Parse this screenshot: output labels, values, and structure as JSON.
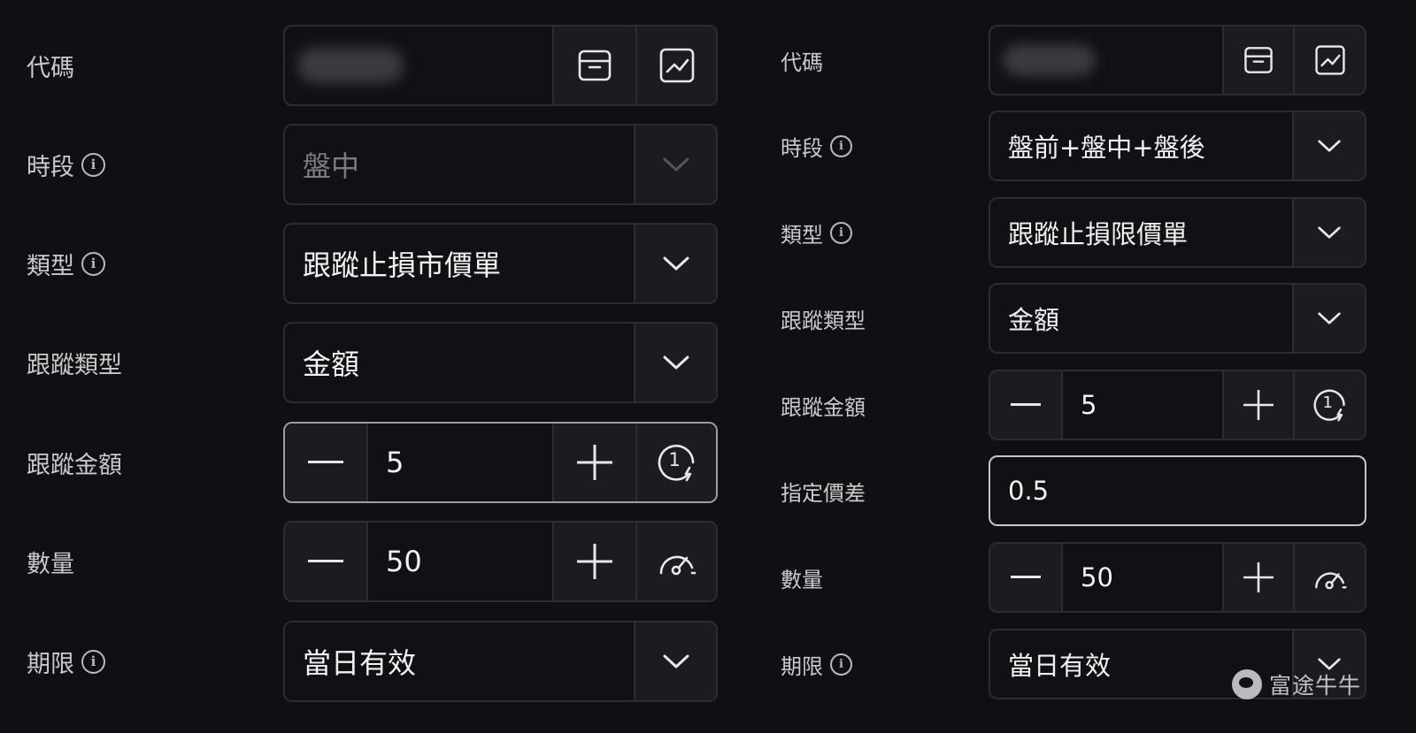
{
  "left": {
    "code": {
      "label": "代碼",
      "icons": [
        "store-icon",
        "chart-icon"
      ]
    },
    "session": {
      "label": "時段",
      "value": "盤中",
      "info": "i"
    },
    "type": {
      "label": "類型",
      "value": "跟蹤止損市價單",
      "info": "i"
    },
    "trail_type": {
      "label": "跟蹤類型",
      "value": "金額"
    },
    "trail_amount": {
      "label": "跟蹤金額",
      "value": "5",
      "badge": "1"
    },
    "quantity": {
      "label": "數量",
      "value": "50"
    },
    "validity": {
      "label": "期限",
      "value": "當日有效",
      "info": "i"
    }
  },
  "right": {
    "code": {
      "label": "代碼",
      "icons": [
        "store-icon",
        "chart-icon"
      ]
    },
    "session": {
      "label": "時段",
      "value": "盤前+盤中+盤後",
      "info": "i"
    },
    "type": {
      "label": "類型",
      "value": "跟蹤止損限價單",
      "info": "i"
    },
    "trail_type": {
      "label": "跟蹤類型",
      "value": "金額"
    },
    "trail_amount": {
      "label": "跟蹤金額",
      "value": "5",
      "badge": "1"
    },
    "spread": {
      "label": "指定價差",
      "value": "0.5"
    },
    "quantity": {
      "label": "數量",
      "value": "50"
    },
    "validity": {
      "label": "期限",
      "value": "當日有效",
      "info": "i"
    }
  },
  "watermark": {
    "text": "富途牛牛"
  },
  "colors": {
    "background": "#0f1013",
    "border": "#2c2d31",
    "active_border": "#9c9da1",
    "button_bg": "#1b1c1f"
  }
}
